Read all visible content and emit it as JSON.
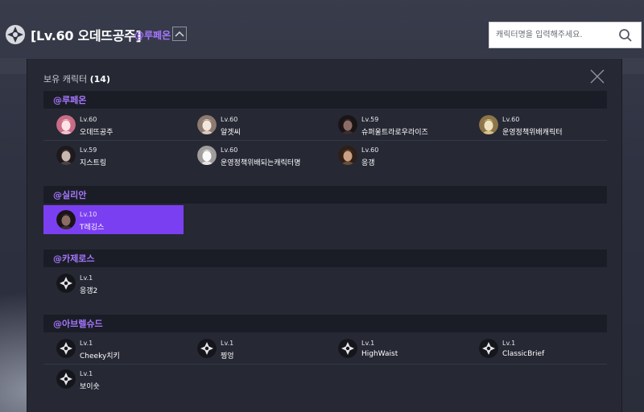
{
  "header": {
    "character_title": "[Lv.60 오데뜨공주]",
    "server_name": "@루페온",
    "search_placeholder": "캐릭터명을 입력해주세요."
  },
  "modal": {
    "title": "보유 캐릭터",
    "count": "(14)",
    "sections": [
      {
        "server": "@루페온",
        "characters": [
          {
            "level": "Lv.60",
            "name": "오데뜨공주",
            "avatar": "portrait-pink"
          },
          {
            "level": "Lv.60",
            "name": "알겟씨",
            "avatar": "portrait-light"
          },
          {
            "level": "Lv.59",
            "name": "슈퍼울트라로우라이즈",
            "avatar": "portrait-dark"
          },
          {
            "level": "Lv.60",
            "name": "운영정책위배캐릭터",
            "avatar": "portrait-blonde"
          },
          {
            "level": "Lv.59",
            "name": "지스트링",
            "avatar": "portrait-hat"
          },
          {
            "level": "Lv.60",
            "name": "운영정책위배되는캐릭터명",
            "avatar": "portrait-white"
          },
          {
            "level": "Lv.60",
            "name": "응갱",
            "avatar": "portrait-brown"
          }
        ]
      },
      {
        "server": "@실리안",
        "characters": [
          {
            "level": "Lv.10",
            "name": "T레깅스",
            "avatar": "portrait-dark",
            "selected": true
          }
        ]
      },
      {
        "server": "@카제로스",
        "characters": [
          {
            "level": "Lv.1",
            "name": "응갱2",
            "avatar": "emblem"
          }
        ]
      },
      {
        "server": "@아브렐슈드",
        "characters": [
          {
            "level": "Lv.1",
            "name": "Cheeky치키",
            "avatar": "emblem"
          },
          {
            "level": "Lv.1",
            "name": "찡엉",
            "avatar": "emblem"
          },
          {
            "level": "Lv.1",
            "name": "HighWaist",
            "avatar": "emblem"
          },
          {
            "level": "Lv.1",
            "name": "ClassicBrief",
            "avatar": "emblem"
          },
          {
            "level": "Lv.1",
            "name": "보이숏",
            "avatar": "emblem"
          }
        ]
      }
    ]
  },
  "colors": {
    "accent": "#a677ff",
    "selected": "#7b3ff2",
    "section_bg": "#1b1d26",
    "modal_bg": "#262834"
  }
}
